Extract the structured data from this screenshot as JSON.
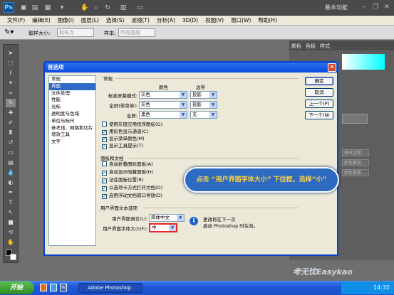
{
  "app": {
    "logo": "Ps",
    "workspace": "基本功能"
  },
  "menu": [
    "文件(F)",
    "编辑(E)",
    "图像(I)",
    "图层(L)",
    "选择(S)",
    "滤镜(T)",
    "分析(A)",
    "3D(D)",
    "视图(V)",
    "窗口(W)",
    "帮助(H)"
  ],
  "options_bar": {
    "sample_size_label": "取样大小:",
    "sample_size_value": "取样点",
    "sample_label": "样本:",
    "sample_value": "所有图层"
  },
  "right_panel": {
    "tabs": [
      "颜色",
      "色板",
      "样式"
    ],
    "buttons": [
      "更改边缘...",
      "颜色蒙版...",
      "颜色蒙版..."
    ]
  },
  "dialog": {
    "title": "首选项",
    "categories": [
      "常规",
      "界面",
      "文件处理",
      "性能",
      "光标",
      "透明度与色域",
      "单位与标尺",
      "参考线、网格和切片",
      "增效工具",
      "文字"
    ],
    "selected_category": "界面",
    "buttons": {
      "ok": "确定",
      "cancel": "取消",
      "prev": "上一个(P)",
      "next": "下一个(N)"
    },
    "general": {
      "title": "常规",
      "col_color": "颜色",
      "col_border": "边界",
      "rows": [
        {
          "label": "标准屏幕模式:",
          "color": "灰色",
          "border": "投影"
        },
        {
          "label": "全屏(带菜单):",
          "color": "灰色",
          "border": "投影"
        },
        {
          "label": "全屏:",
          "color": "黑色",
          "border": "无"
        }
      ],
      "checks": [
        {
          "label": "使用灰度应用程序图标(G)",
          "checked": false
        },
        {
          "label": "用彩色显示通道(C)",
          "checked": true
        },
        {
          "label": "显示菜单颜色(M)",
          "checked": true
        },
        {
          "label": "显示工具提示(T)",
          "checked": true
        }
      ]
    },
    "panels": {
      "title": "面板和文档",
      "checks": [
        {
          "label": "自动折叠图标面板(A)",
          "checked": false
        },
        {
          "label": "自动显示隐藏面板(H)",
          "checked": true
        },
        {
          "label": "记住面板位置(R)",
          "checked": true
        },
        {
          "label": "以选项卡方式打开文档(O)",
          "checked": true
        },
        {
          "label": "启用浮动文档窗口停放(D)",
          "checked": true
        }
      ]
    },
    "ui_text": {
      "title": "用户界面文本选项",
      "lang_label": "用户界面语言(L):",
      "lang_value": "简体中文",
      "size_label": "用户界面字体大小(F):",
      "size_value": "中",
      "note_line1": "更改将在下一次",
      "note_line2": "启动 Photoshop 时生效。"
    }
  },
  "callout": "点击 “用户界面字体大小” 下拉框，选择“小”",
  "taskbar": {
    "start": "开始",
    "task": "Adobe Photoshop",
    "time": "14:32"
  },
  "watermark": "考无忧Easykao"
}
